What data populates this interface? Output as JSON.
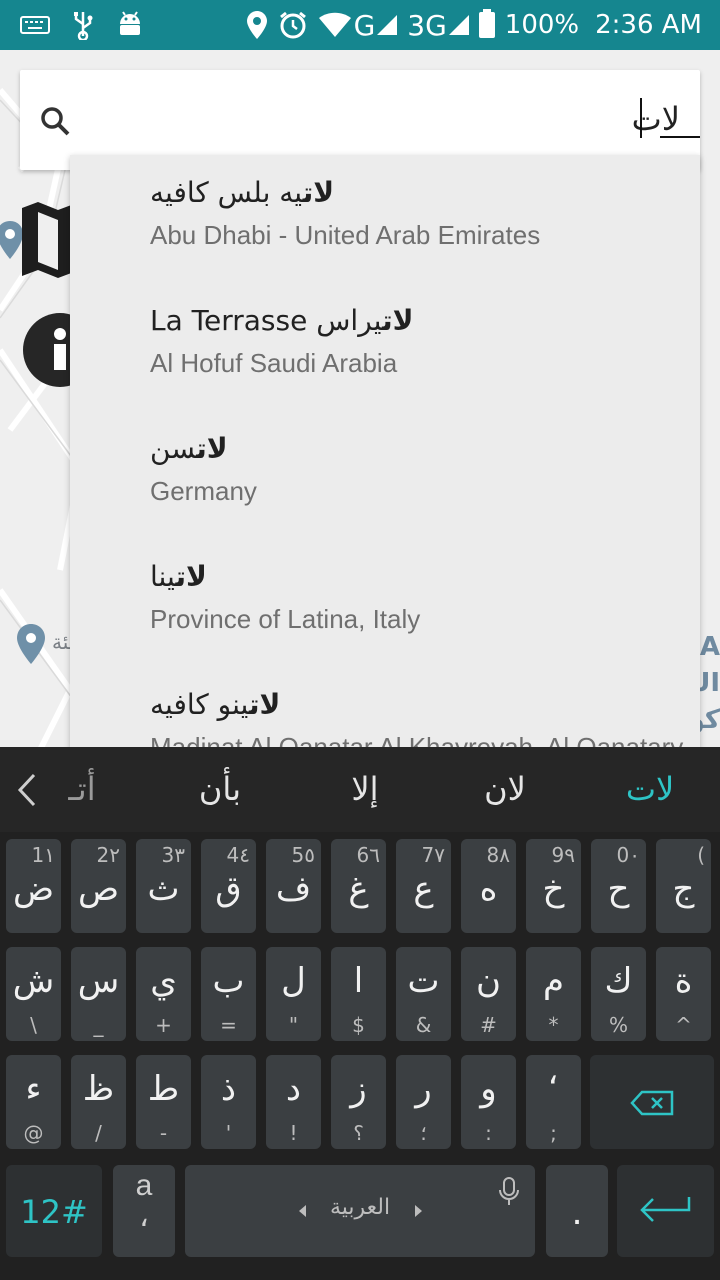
{
  "status_bar": {
    "net_g": "G",
    "net_3g": "3G",
    "battery": "100%",
    "time": "2:36 AM"
  },
  "map": {
    "label_left": "ـئة",
    "label_right_1": "A",
    "label_right_2": "UI",
    "label_right_3": "كو"
  },
  "search": {
    "value": "لات"
  },
  "suggestions": [
    {
      "highlight": "لات",
      "rest": "يه بلس كافيه",
      "prefix": "",
      "subtitle": "Abu Dhabi - United Arab Emirates"
    },
    {
      "highlight": "لات",
      "rest": "يراس",
      "prefix": "La Terrasse ",
      "subtitle": "Al Hofuf Saudi Arabia"
    },
    {
      "highlight": "لات",
      "rest": "سن",
      "prefix": "",
      "subtitle": "Germany"
    },
    {
      "highlight": "لات",
      "rest": "ينا",
      "prefix": "",
      "subtitle": "Province of Latina, Italy"
    },
    {
      "highlight": "لات",
      "rest": "ينو كافيه",
      "prefix": "",
      "subtitle": "Madinat Al Qanatar Al Khayreyah, Al Qanatary"
    }
  ],
  "keyboard": {
    "strip": {
      "items": [
        "أتـ",
        "بأن",
        "إلا",
        "لان",
        "لات"
      ],
      "accent_color": "#2ec4c6"
    },
    "row1": [
      {
        "main": "ض",
        "hint": "1١"
      },
      {
        "main": "ص",
        "hint": "2٢"
      },
      {
        "main": "ث",
        "hint": "3٣"
      },
      {
        "main": "ق",
        "hint": "4٤"
      },
      {
        "main": "ف",
        "hint": "5٥"
      },
      {
        "main": "غ",
        "hint": "6٦"
      },
      {
        "main": "ع",
        "hint": "7٧"
      },
      {
        "main": "ه",
        "hint": "8٨"
      },
      {
        "main": "خ",
        "hint": "9٩"
      },
      {
        "main": "ح",
        "hint": "0٠"
      },
      {
        "main": "ج",
        "hint": "("
      }
    ],
    "row2": [
      {
        "main": "ش",
        "hint": "\\"
      },
      {
        "main": "س",
        "hint": "_"
      },
      {
        "main": "ي",
        "hint": "+"
      },
      {
        "main": "ب",
        "hint": "="
      },
      {
        "main": "ل",
        "hint": "\""
      },
      {
        "main": "ا",
        "hint": "$"
      },
      {
        "main": "ت",
        "hint": "&"
      },
      {
        "main": "ن",
        "hint": "#"
      },
      {
        "main": "م",
        "hint": "*"
      },
      {
        "main": "ك",
        "hint": "%"
      },
      {
        "main": "ة",
        "hint": "^"
      }
    ],
    "row3": [
      {
        "main": "ء",
        "hint": "@"
      },
      {
        "main": "ظ",
        "hint": "/"
      },
      {
        "main": "ط",
        "hint": "-"
      },
      {
        "main": "ذ",
        "hint": "'"
      },
      {
        "main": "د",
        "hint": "!"
      },
      {
        "main": "ز",
        "hint": "؟"
      },
      {
        "main": "ر",
        "hint": "؛"
      },
      {
        "main": "و",
        "hint": ":"
      },
      {
        "main": "ʻ",
        "hint": ";"
      }
    ],
    "symbols_label": "12#",
    "lang_key_top": "a",
    "lang_key_bottom": "،",
    "space_label": "العربية",
    "period_label": "."
  }
}
